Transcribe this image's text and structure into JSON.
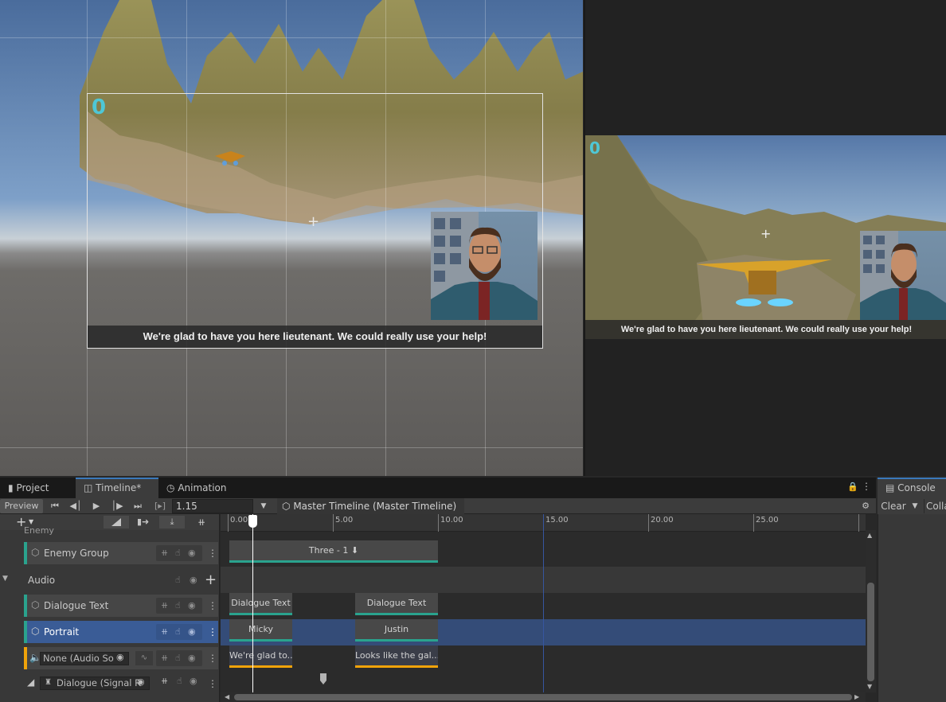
{
  "scene": {
    "score": "0",
    "subtitle": "We're glad to have you here lieutenant.  We could really use your help!"
  },
  "game": {
    "score": "0",
    "subtitle": "We're glad to have you here lieutenant.  We could really use your help!"
  },
  "tabs": {
    "project": "Project",
    "timeline": "Timeline*",
    "animation": "Animation",
    "console": "Console"
  },
  "toolbar": {
    "preview": "Preview",
    "time_value": "1.15",
    "breadcrumb": "Master Timeline (Master Timeline)"
  },
  "console": {
    "clear": "Clear",
    "collapse": "Colla"
  },
  "tracks": {
    "partial_top": "Enemy",
    "enemy_group": "Enemy Group",
    "audio_group": "Audio",
    "dialogue_text": "Dialogue Text",
    "portrait": "Portrait",
    "audio_binding": "None (Audio So",
    "signal_binding": "Dialogue (Signal R"
  },
  "ruler": {
    "labels": [
      "0.00",
      "5.00",
      "10.00",
      "15.00",
      "20.00",
      "25.00"
    ]
  },
  "clips": {
    "enemy": "Three - 1 ⬇",
    "dialogue_1": "Dialogue Text",
    "dialogue_2": "Dialogue Text",
    "portrait_1": "Micky",
    "portrait_2": "Justin",
    "audio_1": "We're glad to...",
    "audio_2": "Looks like the gal..."
  },
  "colors": {
    "accent_blue": "#3a79bb",
    "track_teal": "#2aa38e",
    "audio_orange": "#f0a30a",
    "selected_row": "#3a5c96",
    "score_cyan": "#4ec7d6"
  }
}
